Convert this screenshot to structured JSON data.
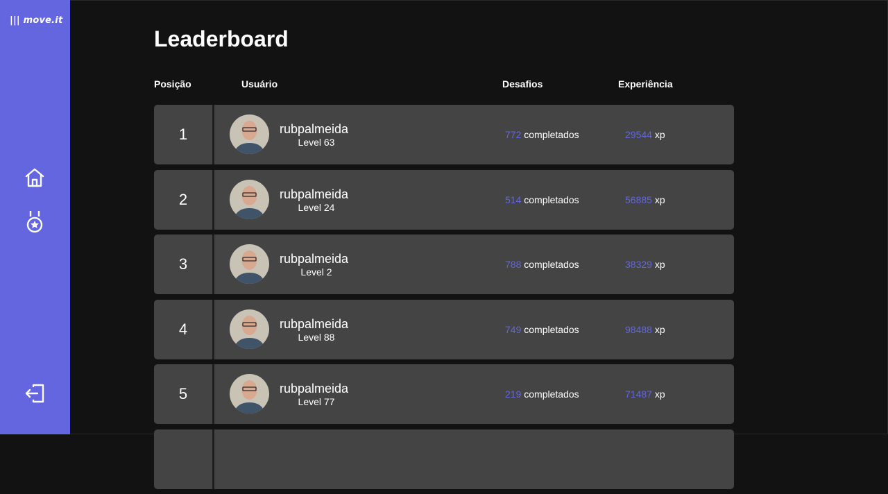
{
  "app": {
    "logo_text": "move.it"
  },
  "sidebar": {
    "items": [
      {
        "name": "home",
        "icon": "home-icon"
      },
      {
        "name": "leaderboard",
        "icon": "award-icon"
      }
    ],
    "logout_icon": "logout-icon"
  },
  "page": {
    "title": "Leaderboard"
  },
  "table": {
    "headers": {
      "position": "Posição",
      "user": "Usuário",
      "challenges": "Desafios",
      "experience": "Experiência"
    },
    "completed_suffix": "completados",
    "xp_suffix": "xp",
    "rows": [
      {
        "position": "1",
        "name": "rubpalmeida",
        "level": "Level 63",
        "challenges": "772",
        "xp": "29544"
      },
      {
        "position": "2",
        "name": "rubpalmeida",
        "level": "Level 24",
        "challenges": "514",
        "xp": "56885"
      },
      {
        "position": "3",
        "name": "rubpalmeida",
        "level": "Level 2",
        "challenges": "788",
        "xp": "38329"
      },
      {
        "position": "4",
        "name": "rubpalmeida",
        "level": "Level 88",
        "challenges": "749",
        "xp": "98488"
      },
      {
        "position": "5",
        "name": "rubpalmeida",
        "level": "Level 77",
        "challenges": "219",
        "xp": "71487"
      }
    ]
  },
  "colors": {
    "accent": "#6366df",
    "background": "#121212",
    "row": "#444444"
  }
}
